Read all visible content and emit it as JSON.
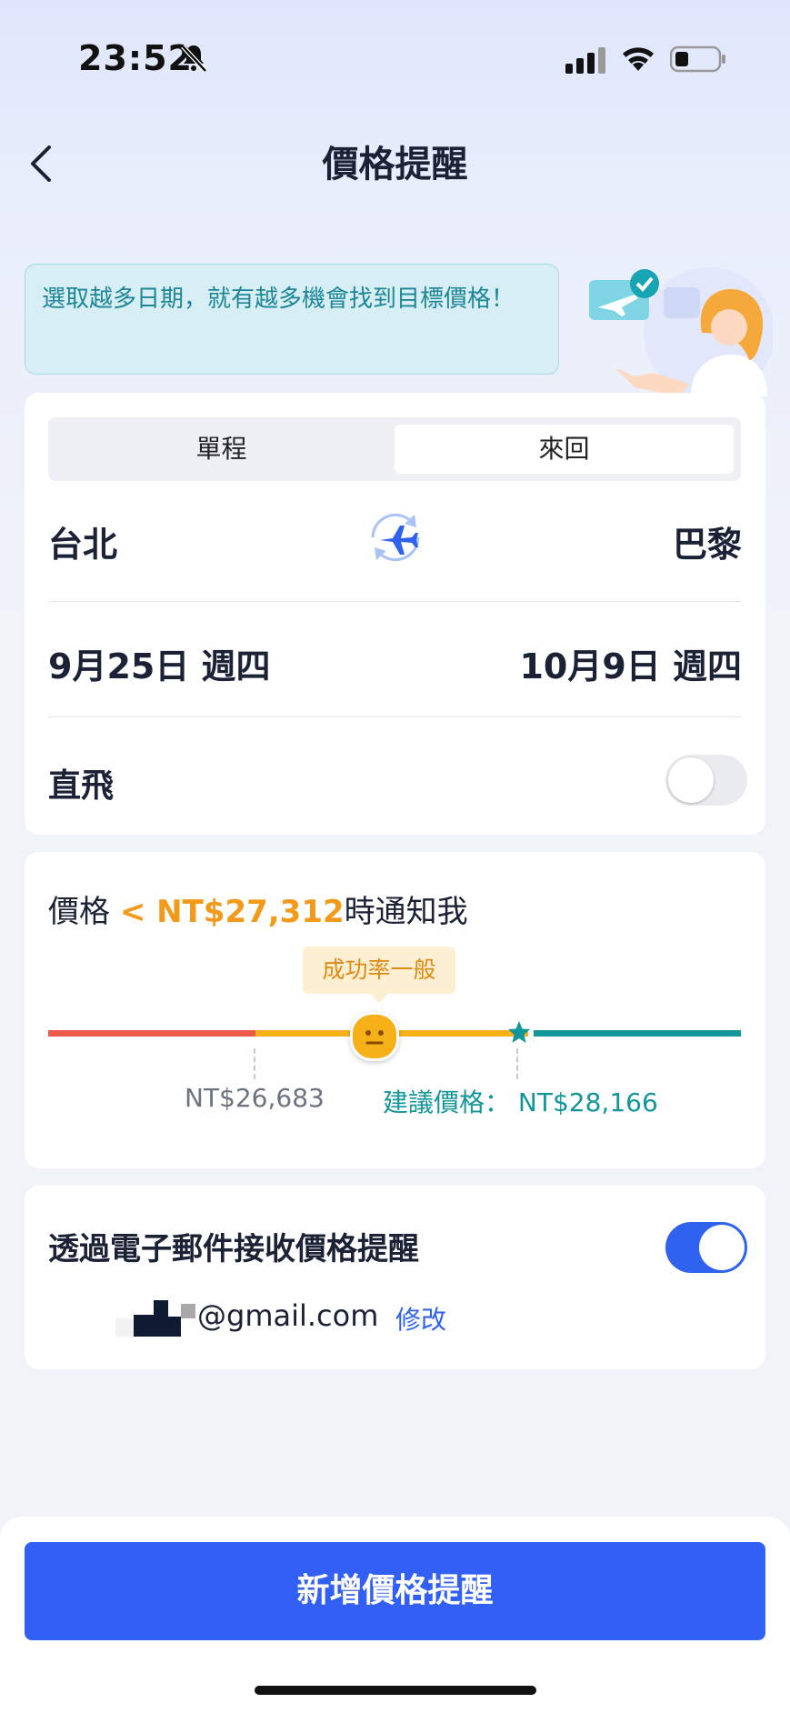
{
  "status_bar": {
    "time": "23:52"
  },
  "header": {
    "title": "價格提醒"
  },
  "tip": {
    "text": "選取越多日期，就有越多機會找到目標價格！"
  },
  "trip_type": {
    "options": [
      "單程",
      "來回"
    ],
    "selected": "來回"
  },
  "route": {
    "from": "台北",
    "to": "巴黎"
  },
  "dates": {
    "depart": "9月25日 週四",
    "return": "10月9日 週四"
  },
  "direct": {
    "label": "直飛",
    "enabled": false
  },
  "price_alert": {
    "prefix": "價格",
    "target": "< NT$27,312",
    "suffix": "時通知我",
    "success_rate": "成功率一般",
    "low_price": "NT$26,683",
    "suggested_label": "建議價格：",
    "suggested_price": "NT$28,166"
  },
  "email": {
    "title": "透過電子郵件接收價格提醒",
    "enabled": true,
    "address": "@gmail.com",
    "edit_label": "修改"
  },
  "cta": {
    "label": "新增價格提醒"
  },
  "colors": {
    "accent": "#3360f4",
    "orange": "#f39a1a",
    "teal": "#12969a",
    "red": "#ec5a4b"
  }
}
